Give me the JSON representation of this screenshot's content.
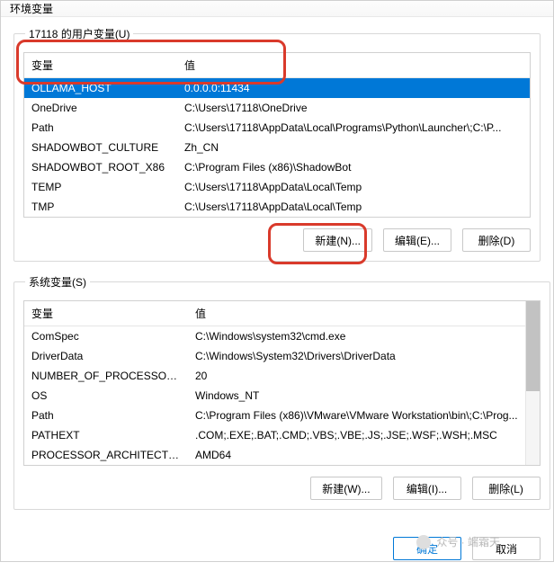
{
  "window": {
    "title": "环境变量"
  },
  "user_section": {
    "legend": "17118 的用户变量(U)",
    "header_name": "变量",
    "header_value": "值",
    "rows": [
      {
        "name": "OLLAMA_HOST",
        "value": "0.0.0.0:11434",
        "selected": true
      },
      {
        "name": "OneDrive",
        "value": "C:\\Users\\17118\\OneDrive"
      },
      {
        "name": "Path",
        "value": "C:\\Users\\17118\\AppData\\Local\\Programs\\Python\\Launcher\\;C:\\P..."
      },
      {
        "name": "SHADOWBOT_CULTURE",
        "value": "Zh_CN"
      },
      {
        "name": "SHADOWBOT_ROOT_X86",
        "value": "C:\\Program Files (x86)\\ShadowBot"
      },
      {
        "name": "TEMP",
        "value": "C:\\Users\\17118\\AppData\\Local\\Temp"
      },
      {
        "name": "TMP",
        "value": "C:\\Users\\17118\\AppData\\Local\\Temp"
      }
    ],
    "buttons": {
      "new": "新建(N)...",
      "edit": "编辑(E)...",
      "delete": "删除(D)"
    }
  },
  "system_section": {
    "legend": "系统变量(S)",
    "header_name": "变量",
    "header_value": "值",
    "rows": [
      {
        "name": "ComSpec",
        "value": "C:\\Windows\\system32\\cmd.exe"
      },
      {
        "name": "DriverData",
        "value": "C:\\Windows\\System32\\Drivers\\DriverData"
      },
      {
        "name": "NUMBER_OF_PROCESSORS",
        "value": "20"
      },
      {
        "name": "OS",
        "value": "Windows_NT"
      },
      {
        "name": "Path",
        "value": "C:\\Program Files (x86)\\VMware\\VMware Workstation\\bin\\;C:\\Prog..."
      },
      {
        "name": "PATHEXT",
        "value": ".COM;.EXE;.BAT;.CMD;.VBS;.VBE;.JS;.JSE;.WSF;.WSH;.MSC"
      },
      {
        "name": "PROCESSOR_ARCHITECTURE",
        "value": "AMD64"
      }
    ],
    "buttons": {
      "new": "新建(W)...",
      "edit": "编辑(I)...",
      "delete": "删除(L)"
    }
  },
  "footer": {
    "ok": "确定",
    "cancel": "取消"
  },
  "watermark": {
    "text": "众号 · 端霜天"
  }
}
